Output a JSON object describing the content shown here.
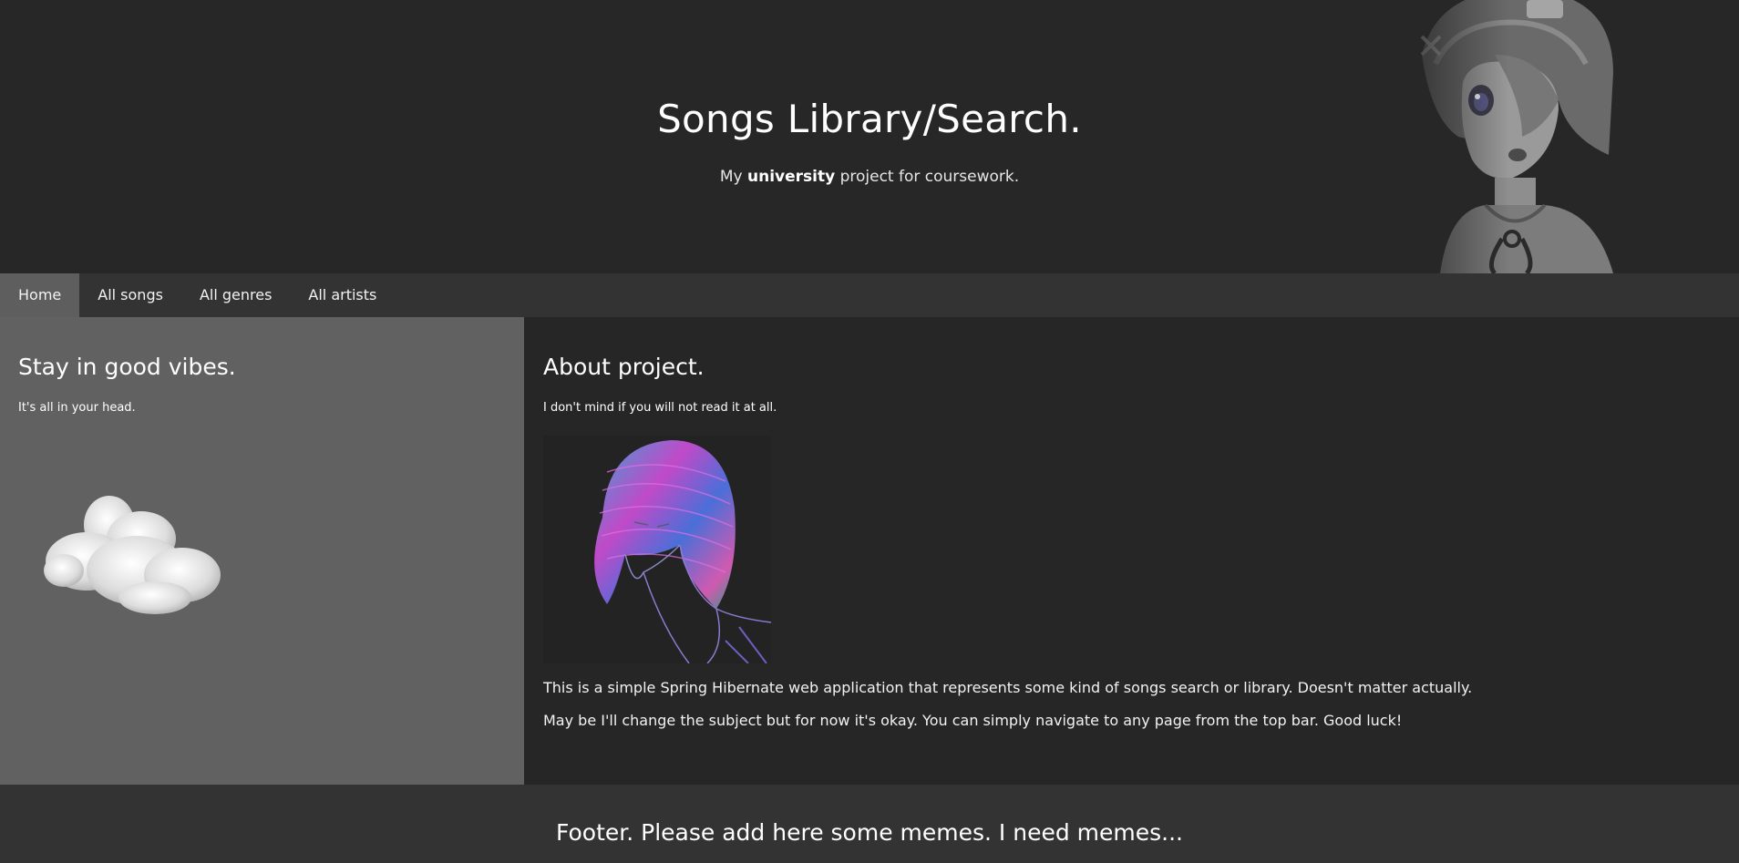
{
  "header": {
    "title": "Songs Library/Search.",
    "subtitle_prefix": "My ",
    "subtitle_bold": "university",
    "subtitle_suffix": " project for coursework."
  },
  "nav": {
    "items": [
      {
        "label": "Home",
        "active": true
      },
      {
        "label": "All songs",
        "active": false
      },
      {
        "label": "All genres",
        "active": false
      },
      {
        "label": "All artists",
        "active": false
      }
    ]
  },
  "left": {
    "title": "Stay in good vibes.",
    "text": "It's all in your head."
  },
  "right": {
    "title": "About project.",
    "note": "I don't mind if you will not read it at all.",
    "paragraph1": "This is a simple Spring Hibernate web application that represents some kind of songs search or library. Doesn't matter actually.",
    "paragraph2": "May be I'll change the subject but for now it's okay. You can simply navigate to any page from the top bar. Good luck!"
  },
  "footer": {
    "text": "Footer. Please add here some memes. I need memes..."
  },
  "colors": {
    "header_bg": "#272727",
    "nav_bg": "#333333",
    "nav_active_bg": "#5e5e5e",
    "left_bg": "#616161",
    "right_bg": "#262626",
    "footer_bg": "#333333"
  }
}
